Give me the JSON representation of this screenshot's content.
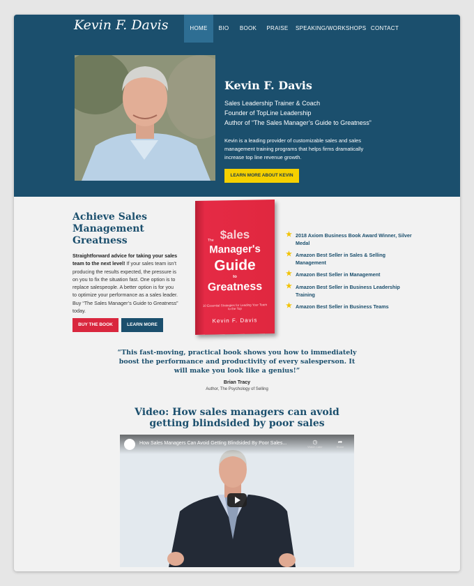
{
  "header": {
    "logo_text": "Kevin F. Davis",
    "nav": [
      {
        "label": "HOME",
        "active": true
      },
      {
        "label": "BIO"
      },
      {
        "label": "BOOK"
      },
      {
        "label": "PRAISE"
      },
      {
        "label": "SPEAKING/WORKSHOPS"
      },
      {
        "label": "CONTACT"
      }
    ]
  },
  "hero": {
    "name": "Kevin F. Davis",
    "lines": [
      "Sales Leadership Trainer & Coach",
      "Founder of TopLine Leadership",
      "Author of “The Sales Manager’s Guide to Greatness”"
    ],
    "description": "Kevin is a leading provider of customizable sales and sales management training programs that helps firms dramatically increase top line revenue growth.",
    "cta_label": "LEARN MORE ABOUT KEVIN"
  },
  "book": {
    "title": "Achieve Sales Management Greatness",
    "lead_bold": "Straightforward advice for taking your sales team to the next level!",
    "lead_rest": " If your sales team isn’t producing the results expected, the pressure is on you to fix the situation fast. One option is to replace salespeople. A better option is for you to optimize your performance as a sales leader. Buy “The Sales Manager’s Guide to Greatness” today.",
    "buy_label": "BUY THE BOOK",
    "learn_label": "LEARN MORE",
    "cover": {
      "the": "The",
      "line1": "$ales",
      "line2": "Manager's",
      "line3": "Guide",
      "line4": "to",
      "line5": "Greatness",
      "subtitle": "10 Essential Strategies for Leading Your Team to the Top",
      "author": "Kevin F. Davis"
    },
    "awards": [
      "2018 Axiom Business Book Award Winner, Silver Medal",
      "Amazon Best Seller in Sales & Selling Management",
      "Amazon Best Seller in Management",
      "Amazon Best Seller in Business Leadership Training",
      "Amazon Best Seller in Business Teams"
    ]
  },
  "quote": {
    "text": "“This fast-moving, practical book shows you how to immediately boost the performance and productivity of every salesperson. It will make you look like a genius!”",
    "name": "Brian Tracy",
    "role": "Author, The Psychology of Selling"
  },
  "video": {
    "heading": "Video: How sales managers can avoid getting blindsided by poor sales",
    "caption": "How Sales Managers Can Avoid Getting Blindsided By Poor Sales...",
    "watch_later": "Watch Later",
    "share": "Share"
  },
  "colors": {
    "navy": "#1b4f6d",
    "nav_active": "#2e6e93",
    "yellow": "#f5d000",
    "red": "#d9273e",
    "star": "#f2c200"
  }
}
